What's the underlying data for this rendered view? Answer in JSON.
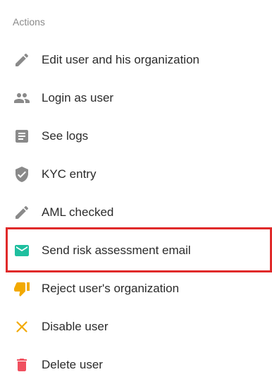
{
  "section": {
    "title": "Actions"
  },
  "actions": [
    {
      "label": "Edit user and his organization",
      "icon": "pencil-icon",
      "color": "#8a8a8a"
    },
    {
      "label": "Login as user",
      "icon": "people-icon",
      "color": "#8a8a8a"
    },
    {
      "label": "See logs",
      "icon": "document-icon",
      "color": "#8a8a8a"
    },
    {
      "label": "KYC entry",
      "icon": "shield-check-icon",
      "color": "#8a8a8a"
    },
    {
      "label": "AML checked",
      "icon": "pencil-icon",
      "color": "#8a8a8a"
    },
    {
      "label": "Send risk assessment email",
      "icon": "envelope-icon",
      "color": "#1fbf9f",
      "highlighted": true
    },
    {
      "label": "Reject user's organization",
      "icon": "thumbs-down-icon",
      "color": "#f2a900"
    },
    {
      "label": "Disable user",
      "icon": "close-icon",
      "color": "#f2a900"
    },
    {
      "label": "Delete user",
      "icon": "trash-icon",
      "color": "#f0505f"
    }
  ],
  "highlight_color": "#e02a2a"
}
